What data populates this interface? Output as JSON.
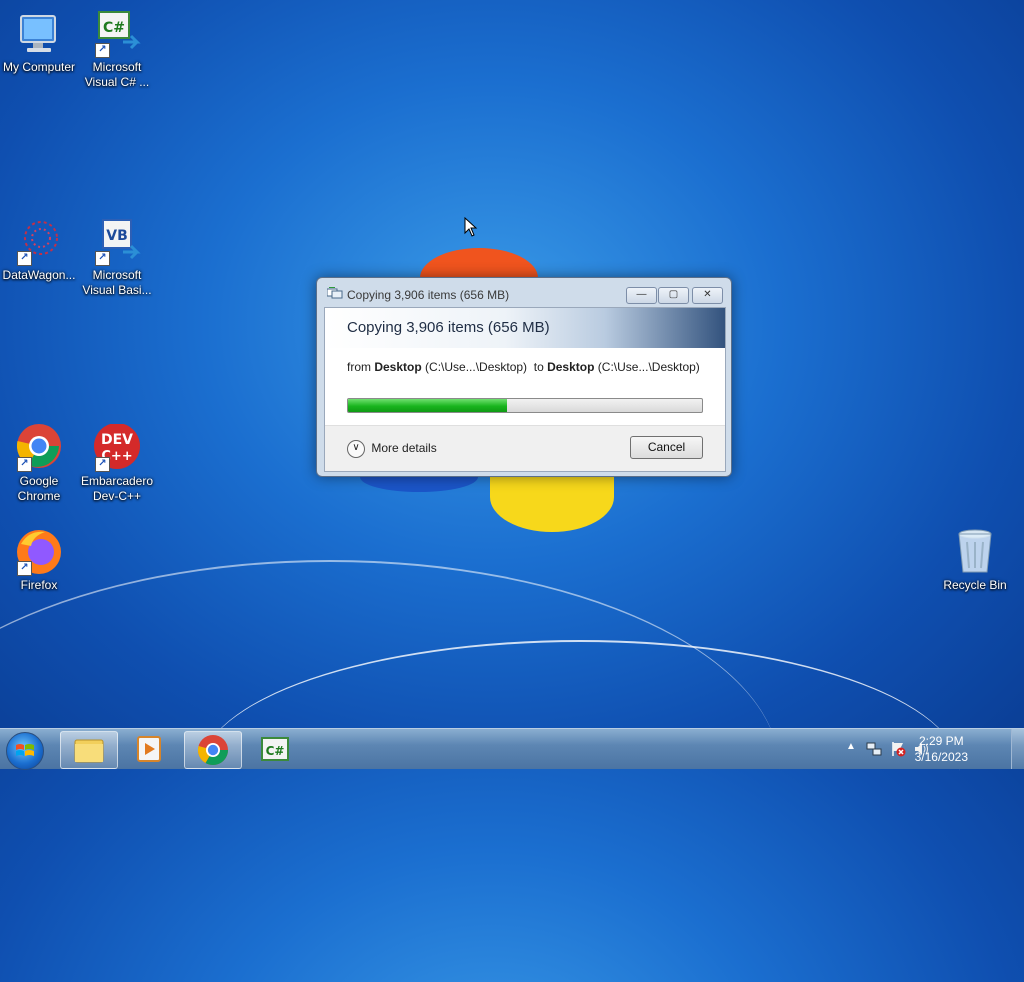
{
  "desktop": {
    "icons": [
      {
        "label_1": "My Computer",
        "label_2": ""
      },
      {
        "label_1": "Microsoft",
        "label_2": "Visual C# ..."
      },
      {
        "label_1": "DataWagon...",
        "label_2": ""
      },
      {
        "label_1": "Microsoft",
        "label_2": "Visual Basi..."
      },
      {
        "label_1": "Google",
        "label_2": "Chrome"
      },
      {
        "label_1": "Embarcadero",
        "label_2": "Dev-C++"
      },
      {
        "label_1": "Firefox",
        "label_2": ""
      },
      {
        "label_1": "Recycle Bin",
        "label_2": ""
      }
    ]
  },
  "dialog": {
    "window_title": "Copying 3,906 items (656 MB)",
    "header_title": "Copying 3,906 items (656 MB)",
    "from_prefix": "from",
    "from_name": "Desktop",
    "from_path": "(C:\\Use...\\Desktop)",
    "to_prefix": "to",
    "to_name": "Desktop",
    "to_path": "(C:\\Use...\\Desktop)",
    "progress_fraction": 0.45,
    "more_details_label": "More details",
    "cancel_label": "Cancel",
    "minimize_glyph": "—",
    "restore_glyph": "▢",
    "close_glyph": "✕"
  },
  "taskbar": {
    "time": "2:29 PM",
    "date": "3/16/2023",
    "pinned": [
      "windows-explorer",
      "media-player",
      "google-chrome",
      "visual-csharp"
    ],
    "tray_icons": [
      "show-hidden-icon",
      "network-icon",
      "action-center-icon",
      "volume-icon"
    ]
  },
  "colors": {
    "progress_green": "#19b51e",
    "wallpaper_blue": "#1b6fd0"
  }
}
